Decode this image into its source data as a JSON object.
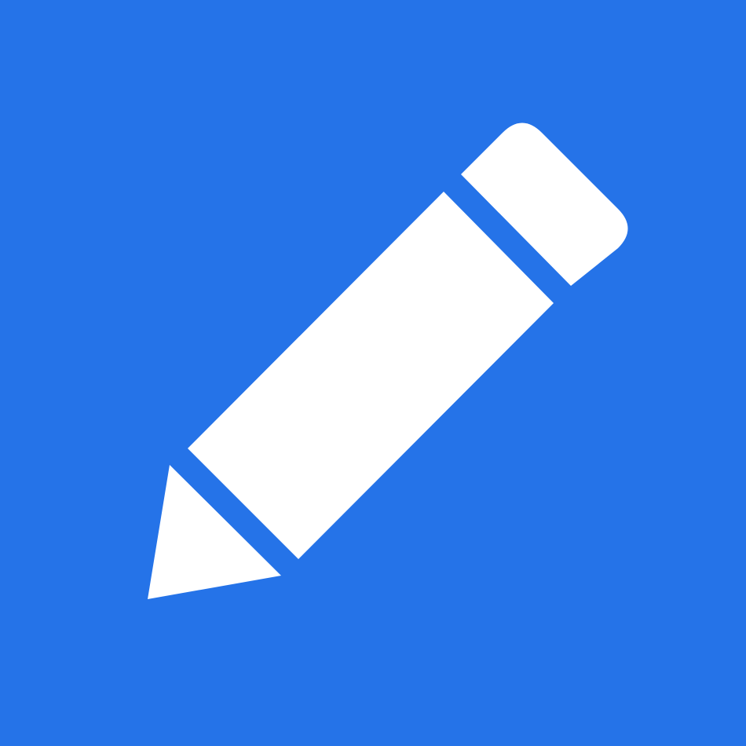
{
  "icon": {
    "name": "pencil-icon",
    "background_color": "#2573E8",
    "foreground_color": "#FFFFFF"
  }
}
